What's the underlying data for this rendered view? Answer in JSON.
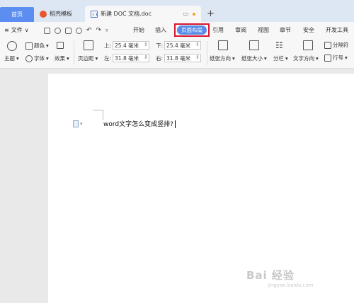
{
  "tabs": {
    "home": "首页",
    "template": "稻壳模板",
    "document": "新建 DOC 文档.doc",
    "new_tab": "+"
  },
  "menubar": {
    "file": "文件",
    "items": [
      "开始",
      "插入",
      "页面布局",
      "引用",
      "审阅",
      "视图",
      "章节",
      "安全",
      "开发工具"
    ],
    "active": "页面布局"
  },
  "toolbar": {
    "theme": "主题",
    "color": "颜色",
    "font": "字体",
    "effect": "效果",
    "margins": "页边距",
    "top_label": "上:",
    "top_value": "25.4 毫米",
    "bottom_label": "下:",
    "bottom_value": "25.4 毫米",
    "left_label": "左:",
    "left_value": "31.8 毫米",
    "right_label": "右:",
    "right_value": "31.8 毫米",
    "orientation": "纸张方向",
    "size": "纸张大小",
    "columns": "分栏",
    "text_direction": "文字方向",
    "separator": "分隔符",
    "line_numbers": "行号"
  },
  "document": {
    "text": "word文字怎么变成竖排?"
  },
  "watermark": {
    "main": "Bai 经验",
    "sub": "jingyan.baidu.com"
  },
  "colors": {
    "active_tab": "#5a8de8",
    "highlight_border": "#d9172c",
    "home_tab": "#5b8ef0"
  }
}
